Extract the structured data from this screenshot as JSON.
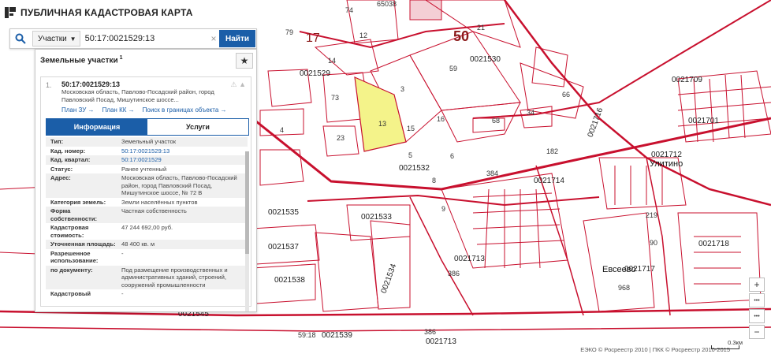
{
  "app": {
    "title": "ПУБЛИЧНАЯ КАДАСТРОВАЯ КАРТА"
  },
  "search": {
    "type_selected": "Участки",
    "query": "50:17:0021529:13",
    "button_label": "Найти",
    "clear_symbol": "×"
  },
  "panel": {
    "title": "Земельные участки",
    "count_sup": "1",
    "star": "★"
  },
  "result": {
    "index": "1.",
    "cad_number": "50:17:0021529:13",
    "address": "Московская область, Павлово-Посадский район, город Павловский Посад, Мишутинское шоссе...",
    "links": [
      "План ЗУ →",
      "План КК →",
      "Поиск в границах объекта →"
    ],
    "tabs": {
      "info": "Информация",
      "services": "Услуги"
    },
    "properties": [
      {
        "key": "Тип:",
        "value": "Земельный участок"
      },
      {
        "key": "Кад. номер:",
        "value": "50:17:0021529:13"
      },
      {
        "key": "Кад. квартал:",
        "value": "50:17:0021529"
      },
      {
        "key": "Статус:",
        "value": "Ранее учтенный"
      },
      {
        "key": "Адрес:",
        "value": "Московская область, Павлово-Посадский район, город Павловский Посад, Мишутинское шоссе, № 72 В"
      },
      {
        "key": "Категория земель:",
        "value": "Земли населённых пунктов"
      },
      {
        "key": "Форма собственности:",
        "value": "Частная собственность"
      },
      {
        "key": "Кадастровая стоимость:",
        "value": "47 244 692,00 руб."
      },
      {
        "key": "Уточненная площадь:",
        "value": "48 400 кв. м"
      },
      {
        "key": "Разрешенное использование:",
        "value": "-"
      },
      {
        "key": "по документу:",
        "value": "Под размещение производственных и административных зданий, строений, сооружений промышленности"
      },
      {
        "key": "Кадастровый",
        "value": "-"
      }
    ]
  },
  "map": {
    "labels": [
      {
        "t": "17",
        "cls": "mid"
      },
      {
        "t": "50",
        "cls": "big"
      },
      {
        "t": "79",
        "cls": ""
      },
      {
        "t": "74",
        "cls": ""
      },
      {
        "t": "65038",
        "cls": ""
      },
      {
        "t": "12",
        "cls": ""
      },
      {
        "t": "14",
        "cls": ""
      },
      {
        "t": "0021529",
        "cls": "quarter"
      },
      {
        "t": "0021530",
        "cls": "quarter"
      },
      {
        "t": "59",
        "cls": ""
      },
      {
        "t": "73",
        "cls": ""
      },
      {
        "t": "3",
        "cls": ""
      },
      {
        "t": "13",
        "cls": ""
      },
      {
        "t": "15",
        "cls": ""
      },
      {
        "t": "16",
        "cls": ""
      },
      {
        "t": "23",
        "cls": ""
      },
      {
        "t": "4",
        "cls": ""
      },
      {
        "t": "68",
        "cls": ""
      },
      {
        "t": "66",
        "cls": ""
      },
      {
        "t": "0021532",
        "cls": "quarter"
      },
      {
        "t": "6",
        "cls": ""
      },
      {
        "t": "182",
        "cls": ""
      },
      {
        "t": "384",
        "cls": ""
      },
      {
        "t": "0021714",
        "cls": "quarter"
      },
      {
        "t": "0021709",
        "cls": "quarter"
      },
      {
        "t": "0021701",
        "cls": "quarter"
      },
      {
        "t": "0021712",
        "cls": "quarter"
      },
      {
        "t": "Улитино",
        "cls": "place"
      },
      {
        "t": "0021716",
        "cls": "quarter"
      },
      {
        "t": "0021533",
        "cls": "quarter"
      },
      {
        "t": "0021535",
        "cls": "quarter"
      },
      {
        "t": "0021537",
        "cls": "quarter"
      },
      {
        "t": "0021538",
        "cls": "quarter"
      },
      {
        "t": "0021534",
        "cls": "quarter"
      },
      {
        "t": "0021713",
        "cls": "quarter"
      },
      {
        "t": "386",
        "cls": ""
      },
      {
        "t": "Евсеево",
        "cls": "place"
      },
      {
        "t": "0021717",
        "cls": "quarter"
      },
      {
        "t": "0021718",
        "cls": "quarter"
      },
      {
        "t": "0021545",
        "cls": "quarter"
      },
      {
        "t": "0021539",
        "cls": "quarter"
      },
      {
        "t": "59:18",
        "cls": ""
      },
      {
        "t": "386",
        "cls": ""
      },
      {
        "t": "0021713",
        "cls": "quarter"
      },
      {
        "t": "219",
        "cls": ""
      },
      {
        "t": "90",
        "cls": ""
      },
      {
        "t": "968",
        "cls": ""
      },
      {
        "t": "21",
        "cls": ""
      },
      {
        "t": "34",
        "cls": ""
      },
      {
        "t": "5",
        "cls": ""
      },
      {
        "t": "8",
        "cls": ""
      },
      {
        "t": "9",
        "cls": ""
      }
    ]
  },
  "zoom": {
    "in": "+",
    "dots": "•••",
    "out": "−"
  },
  "footer": {
    "copyright": "ЕЭКО © Росреестр 2010 | ПКК © Росреестр 2010-2015",
    "scale": "0.3км"
  },
  "colors": {
    "accent": "#1b5ea8",
    "boundary": "#c8102e",
    "selected_fill": "#f4f38a"
  }
}
